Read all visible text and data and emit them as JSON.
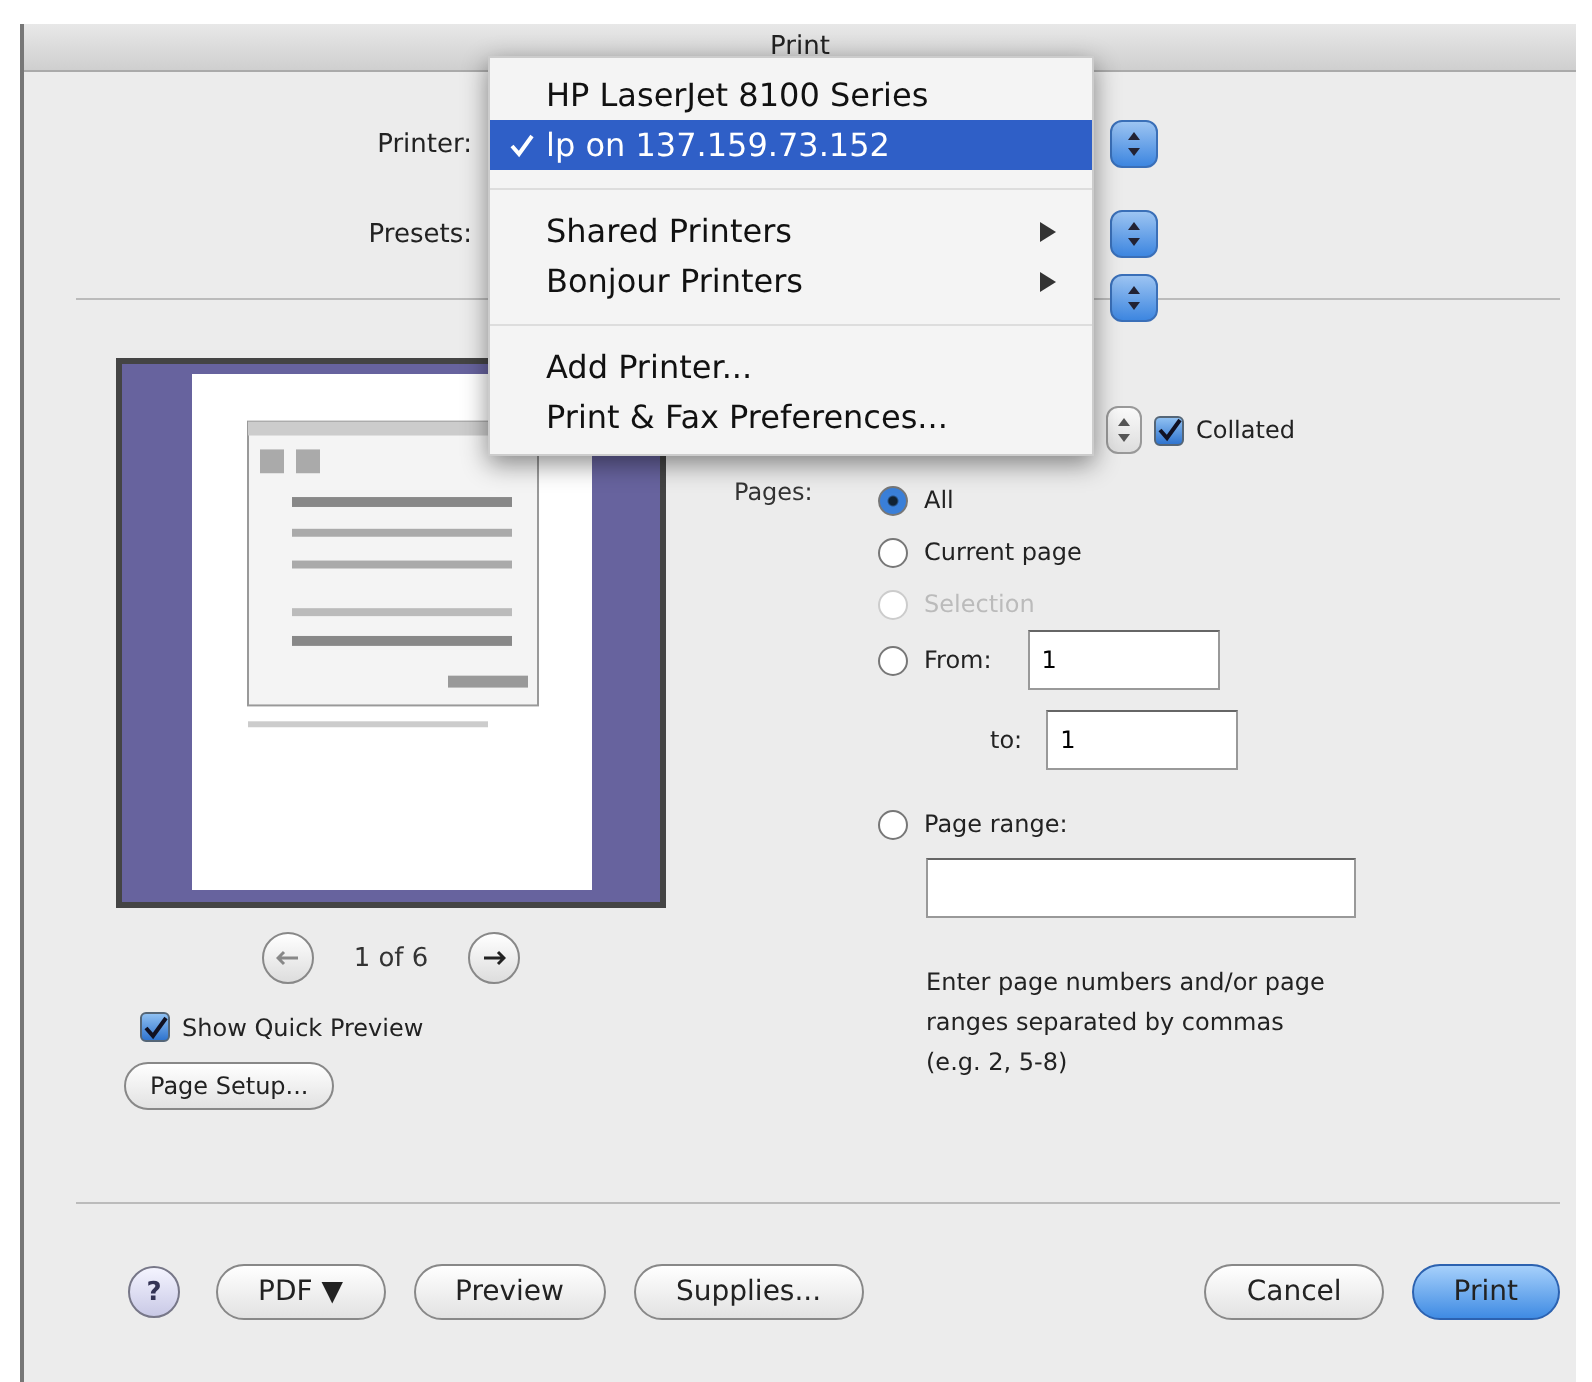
{
  "window": {
    "title": "Print"
  },
  "printer": {
    "label": "Printer:"
  },
  "presets": {
    "label": "Presets:"
  },
  "printer_menu": {
    "items": [
      {
        "kind": "item",
        "label": "HP LaserJet 8100 Series",
        "selected": false,
        "checked": false
      },
      {
        "kind": "item",
        "label": "lp on 137.159.73.152",
        "selected": true,
        "checked": true
      },
      {
        "kind": "separator"
      },
      {
        "kind": "submenu",
        "label": "Shared Printers",
        "selected": false,
        "checked": false
      },
      {
        "kind": "submenu",
        "label": "Bonjour Printers",
        "selected": false,
        "checked": false
      },
      {
        "kind": "separator"
      },
      {
        "kind": "item",
        "label": "Add Printer...",
        "selected": false,
        "checked": false
      },
      {
        "kind": "item",
        "label": "Print & Fax Preferences...",
        "selected": false,
        "checked": false
      }
    ]
  },
  "preview": {
    "page_indicator": "1 of 6",
    "show_quick_preview": {
      "label": "Show Quick Preview",
      "checked": true
    },
    "page_setup_button": "Page Setup..."
  },
  "copies": {
    "collated": {
      "label": "Collated",
      "checked": true
    }
  },
  "pages": {
    "label": "Pages:",
    "options": [
      {
        "kind": "plain",
        "label": "All",
        "selected": true,
        "disabled": false
      },
      {
        "kind": "plain",
        "label": "Current page",
        "selected": false,
        "disabled": false
      },
      {
        "kind": "plain",
        "label": "Selection",
        "selected": false,
        "disabled": true
      },
      {
        "kind": "from",
        "label": "From:",
        "selected": false,
        "disabled": false,
        "value": "1",
        "to_label": "to:",
        "to_value": "1"
      },
      {
        "kind": "range",
        "label": "Page range:",
        "selected": false,
        "disabled": false,
        "hint": "Enter page numbers and/or page ranges separated by commas (e.g. 2, 5-8)"
      }
    ]
  },
  "buttons": [
    {
      "kind": "help",
      "label": "?"
    },
    {
      "kind": "plain",
      "label": "PDF ▼"
    },
    {
      "kind": "plain",
      "label": "Preview"
    },
    {
      "kind": "plain",
      "label": "Supplies..."
    },
    {
      "kind": "spacer"
    },
    {
      "kind": "plain",
      "label": "Cancel"
    },
    {
      "kind": "default",
      "label": "Print"
    }
  ]
}
